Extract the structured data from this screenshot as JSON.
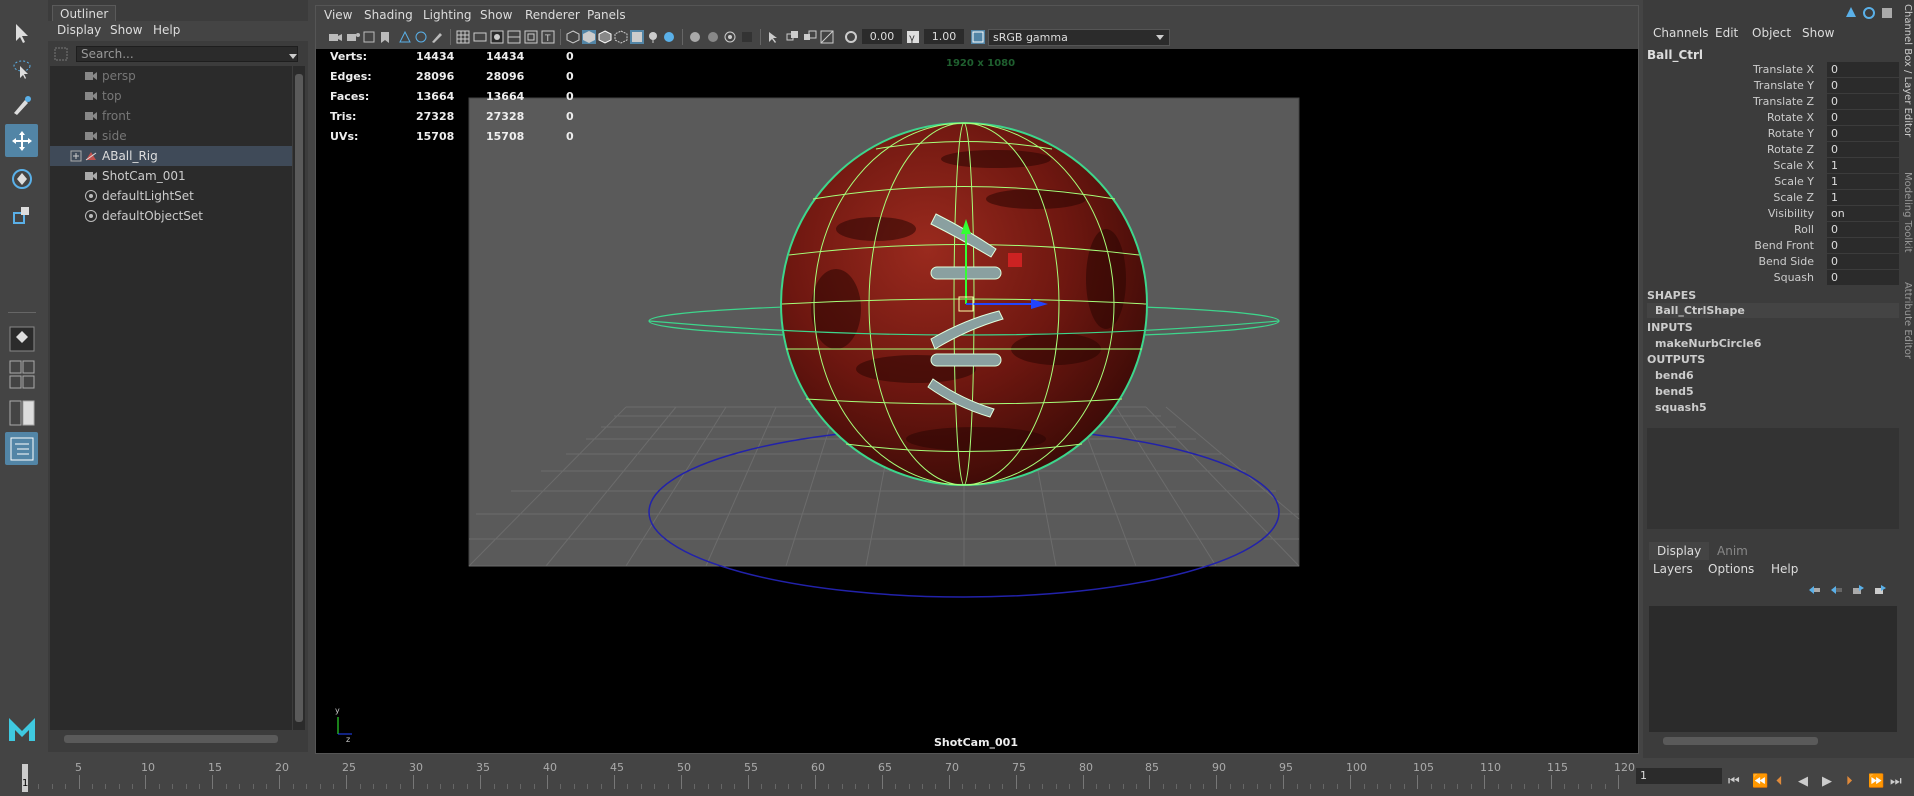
{
  "toolbox": {
    "tools": [
      "select-tool",
      "lasso-tool",
      "paint-select-tool",
      "move-tool",
      "rotate-tool",
      "scale-tool"
    ]
  },
  "outliner": {
    "tab_label": "Outliner",
    "menu": [
      "Display",
      "Show",
      "Help"
    ],
    "search_placeholder": "Search...",
    "items": [
      {
        "label": "persp",
        "icon": "camera-icon",
        "dim": true
      },
      {
        "label": "top",
        "icon": "camera-icon",
        "dim": true
      },
      {
        "label": "front",
        "icon": "camera-icon",
        "dim": true
      },
      {
        "label": "side",
        "icon": "camera-icon",
        "dim": true
      },
      {
        "label": "ABall_Rig",
        "icon": "transform-icon",
        "dim": false,
        "selected": true
      },
      {
        "label": "ShotCam_001",
        "icon": "camera-icon",
        "dim": false
      },
      {
        "label": "defaultLightSet",
        "icon": "set-icon",
        "dim": false
      },
      {
        "label": "defaultObjectSet",
        "icon": "set-icon",
        "dim": false
      }
    ]
  },
  "viewport": {
    "menu": [
      "View",
      "Shading",
      "Lighting",
      "Show",
      "Renderer",
      "Panels"
    ],
    "exposure": "0.00",
    "gamma": "1.00",
    "color_space": "sRGB gamma",
    "resolution_label": "1920 x 1080",
    "camera_label": "ShotCam_001",
    "hud": [
      {
        "name": "Verts:",
        "a": "14434",
        "b": "14434",
        "c": "0"
      },
      {
        "name": "Edges:",
        "a": "28096",
        "b": "28096",
        "c": "0"
      },
      {
        "name": "Faces:",
        "a": "13664",
        "b": "13664",
        "c": "0"
      },
      {
        "name": "Tris:",
        "a": "27328",
        "b": "27328",
        "c": "0"
      },
      {
        "name": "UVs:",
        "a": "15708",
        "b": "15708",
        "c": "0"
      }
    ],
    "colors": {
      "ball": "#7a1a12",
      "wire": "#a8ff7a",
      "nurbs": "#3dd68c",
      "ground_circle": "#2222aa"
    }
  },
  "channel_box": {
    "menu": [
      "Channels",
      "Edit",
      "Object",
      "Show"
    ],
    "object": "Ball_Ctrl",
    "attributes": [
      {
        "name": "Translate X",
        "value": "0"
      },
      {
        "name": "Translate Y",
        "value": "0"
      },
      {
        "name": "Translate Z",
        "value": "0"
      },
      {
        "name": "Rotate X",
        "value": "0"
      },
      {
        "name": "Rotate Y",
        "value": "0"
      },
      {
        "name": "Rotate Z",
        "value": "0"
      },
      {
        "name": "Scale X",
        "value": "1"
      },
      {
        "name": "Scale Y",
        "value": "1"
      },
      {
        "name": "Scale Z",
        "value": "1"
      },
      {
        "name": "Visibility",
        "value": "on"
      },
      {
        "name": "Roll",
        "value": "0"
      },
      {
        "name": "Bend Front",
        "value": "0"
      },
      {
        "name": "Bend Side",
        "value": "0"
      },
      {
        "name": "Squash",
        "value": "0"
      }
    ],
    "shapes_header": "SHAPES",
    "shape": "Ball_CtrlShape",
    "inputs_header": "INPUTS",
    "inputs": [
      "makeNurbCircle6"
    ],
    "outputs_header": "OUTPUTS",
    "outputs": [
      "bend6",
      "bend5",
      "squash5"
    ]
  },
  "layer_editor": {
    "tabs": [
      "Display",
      "Anim"
    ],
    "menu": [
      "Layers",
      "Options",
      "Help"
    ]
  },
  "side_tabs": [
    "Channel Box / Layer Editor",
    "Modeling Toolkit",
    "Attribute Editor"
  ],
  "time_slider": {
    "ticks": [
      "5",
      "10",
      "15",
      "20",
      "25",
      "30",
      "35",
      "40",
      "45",
      "50",
      "55",
      "60",
      "65",
      "70",
      "75",
      "80",
      "85",
      "90",
      "95",
      "100",
      "105",
      "110",
      "115",
      "120"
    ],
    "current_frame": "1",
    "frame_field": "1"
  }
}
